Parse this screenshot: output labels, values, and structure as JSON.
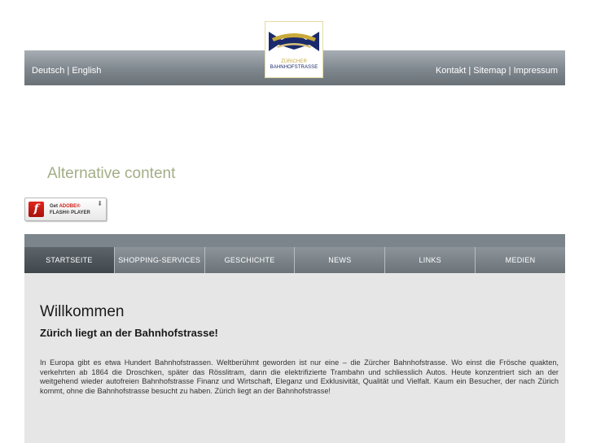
{
  "header": {
    "lang_de": "Deutsch",
    "lang_sep": " | ",
    "lang_en": "English",
    "links": [
      "Kontakt",
      "Sitemap",
      "Impressum"
    ],
    "link_sep": " | ",
    "logo": {
      "line1": "ZÜRICHER",
      "line2": "BAHNHOFSTRASSE"
    }
  },
  "alternative_content": "Alternative content",
  "flash": {
    "get": "Get",
    "adobe": "ADOBE®",
    "player": "FLASH® PLAYER"
  },
  "nav": {
    "items": [
      "STARTSEITE",
      "SHOPPING-SERVICES",
      "GESCHICHTE",
      "NEWS",
      "LINKS",
      "MEDIEN"
    ],
    "active": "STARTSEITE"
  },
  "main": {
    "title": "Willkommen",
    "subtitle": "Zürich liegt an der Bahnhofstrasse!",
    "body": "In Europa gibt es etwa Hundert Bahnhofstrassen. Weltberühmt geworden ist nur eine – die Zürcher Bahnhofstrasse. Wo einst die Frösche quakten, verkehrten ab 1864 die Droschken, später das Rösslitram, dann die elektrifizierte Trambahn und schliesslich Autos. Heute konzentriert sich an der weitgehend wieder autofreien Bahnhofstrasse Finanz und Wirtschaft, Eleganz und Exklusivität, Qualität und Vielfalt. Kaum ein Besucher, der nach Zürich kommt, ohne die Bahnhofstrasse besucht zu haben. Zürich liegt an der Bahnhofstrasse!"
  },
  "colors": {
    "header_bar": "#7f878e",
    "nav_active": "#4a5258",
    "content_bg": "#e6e6e6",
    "alt_text": "#a2ae86",
    "logo_navy": "#1a2a6c",
    "logo_gold": "#c9a93a"
  }
}
